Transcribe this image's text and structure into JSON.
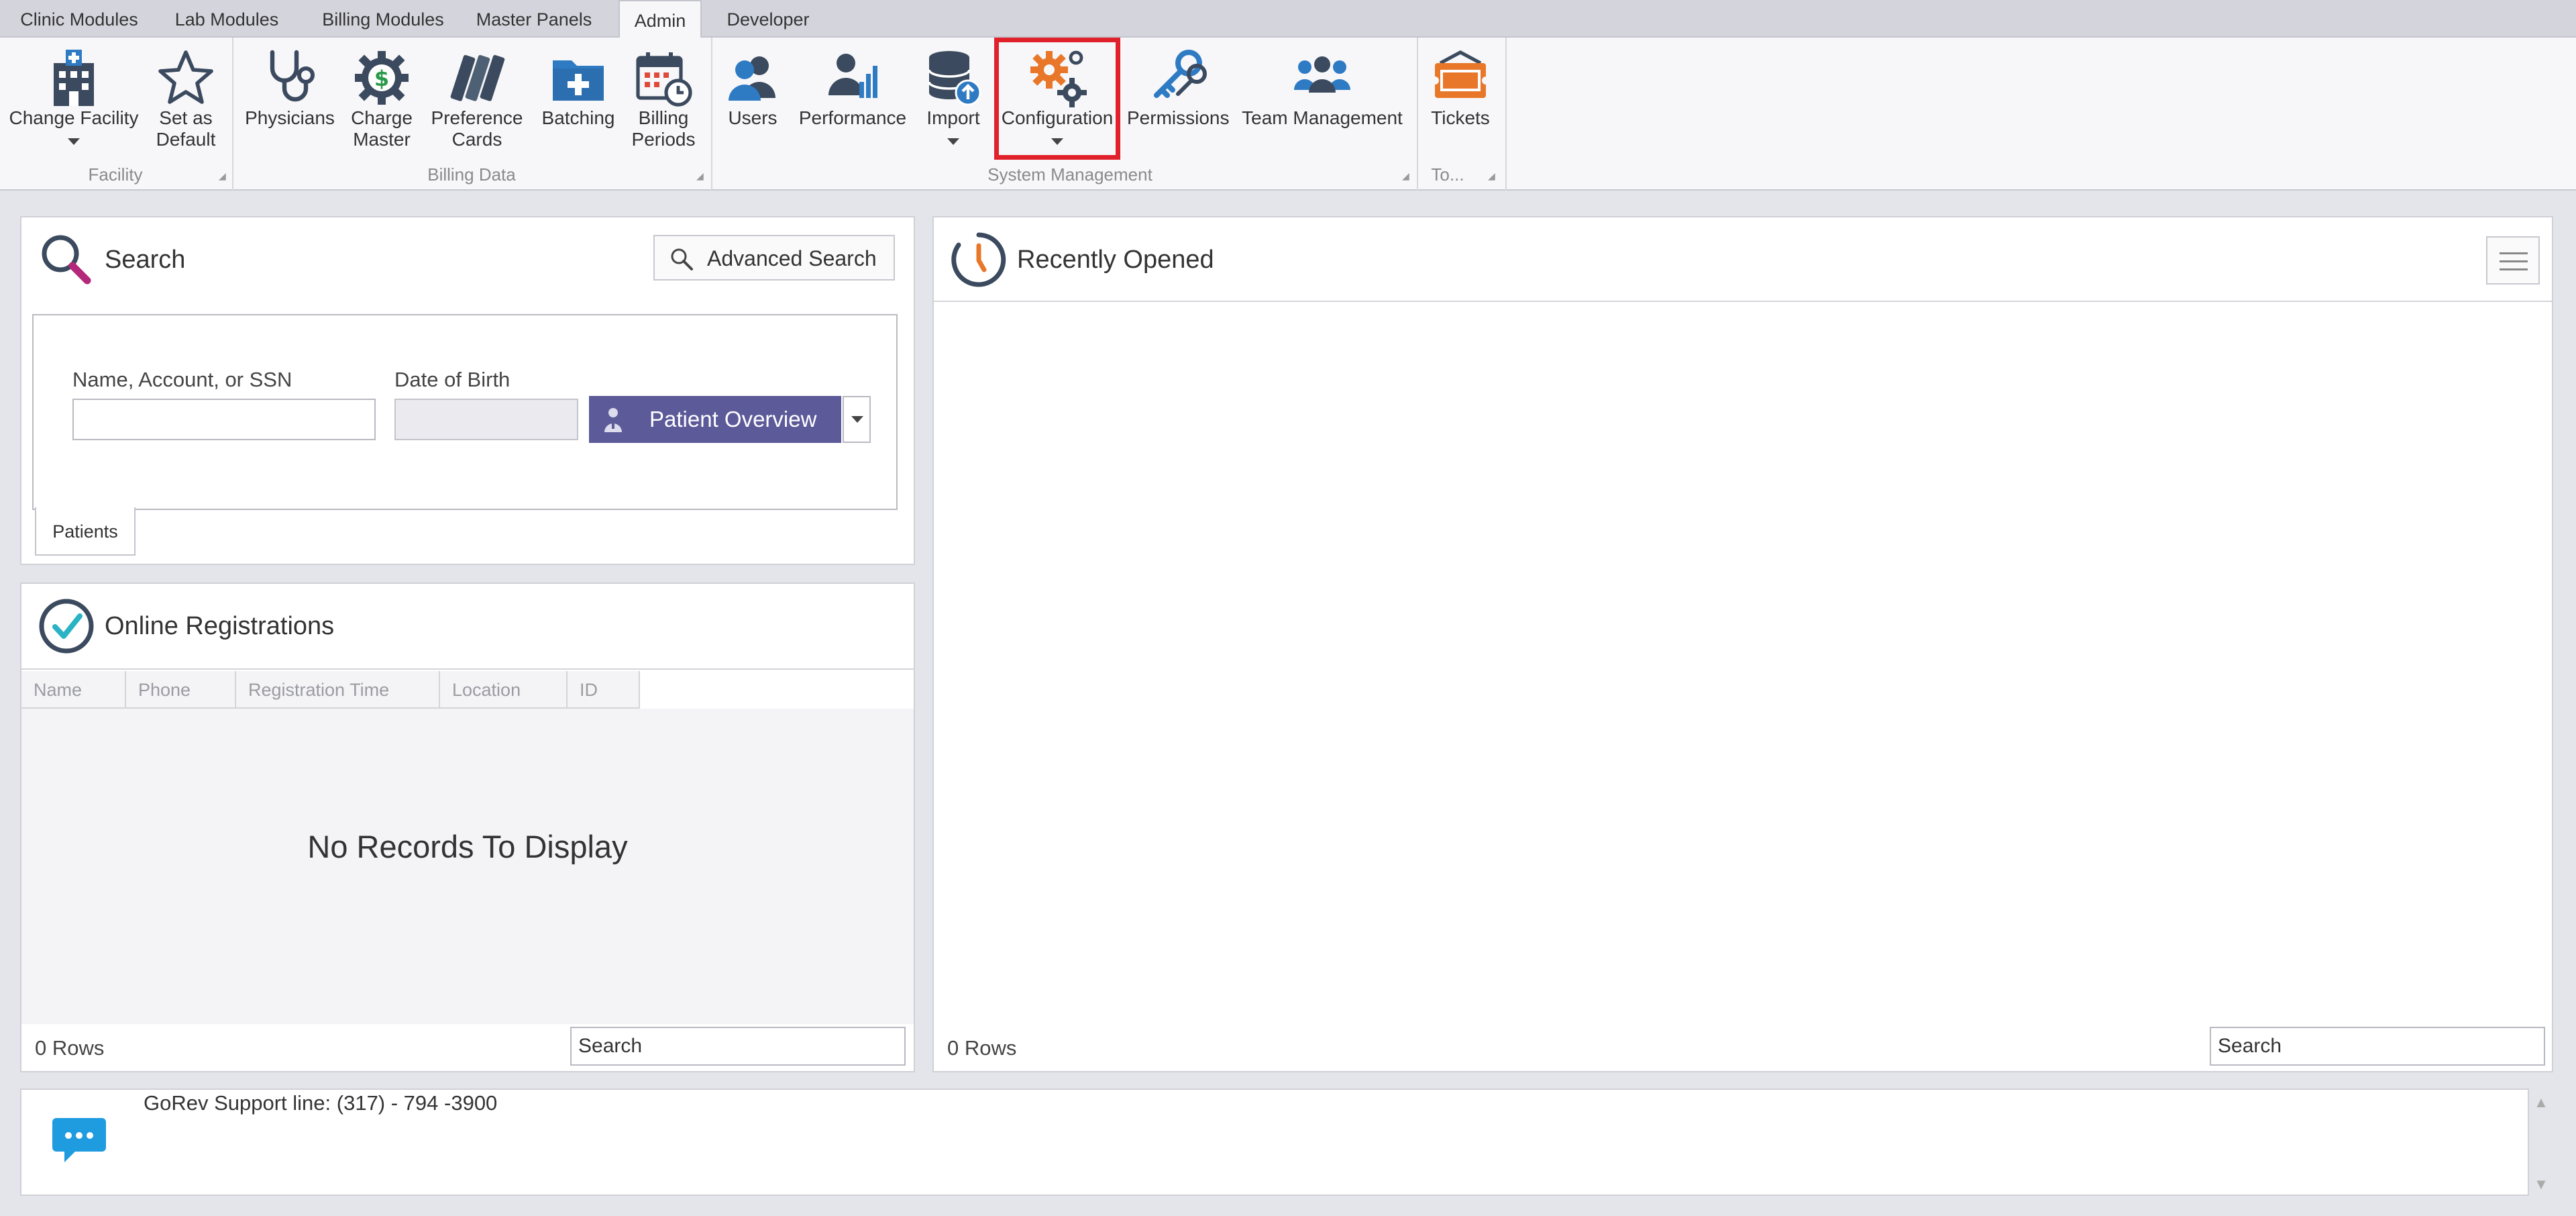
{
  "tabs": [
    {
      "label": "Clinic Modules",
      "active": false
    },
    {
      "label": "Lab Modules",
      "active": false
    },
    {
      "label": "Billing Modules",
      "active": false
    },
    {
      "label": "Master Panels",
      "active": false
    },
    {
      "label": "Admin",
      "active": true
    },
    {
      "label": "Developer",
      "active": false
    }
  ],
  "ribbon": {
    "groups": {
      "facility": "Facility",
      "billing_data": "Billing Data",
      "system_management": "System Management",
      "tools": "To..."
    },
    "buttons": {
      "change_facility": "Change Facility",
      "set_default_1": "Set as",
      "set_default_2": "Default",
      "physicians": "Physicians",
      "charge_master_1": "Charge",
      "charge_master_2": "Master",
      "preference_cards_1": "Preference",
      "preference_cards_2": "Cards",
      "batching": "Batching",
      "billing_periods_1": "Billing",
      "billing_periods_2": "Periods",
      "users": "Users",
      "performance": "Performance",
      "import": "Import",
      "configuration": "Configuration",
      "permissions": "Permissions",
      "team_management": "Team Management",
      "tickets": "Tickets"
    },
    "icons": {
      "change_facility": "hospital-icon",
      "set_default": "star-icon",
      "physicians": "stethoscope-icon",
      "charge_master": "dollar-gear-icon",
      "preference_cards": "cards-icon",
      "batching": "medical-folder-icon",
      "billing_periods": "calendar-clock-icon",
      "users": "users-icon",
      "performance": "user-chart-icon",
      "import": "database-upload-icon",
      "configuration": "gears-icon",
      "permissions": "keys-icon",
      "team_management": "team-icon",
      "tickets": "ticket-icon"
    }
  },
  "search": {
    "title": "Search",
    "advanced_label": "Advanced Search",
    "name_label": "Name, Account, or SSN",
    "name_value": "",
    "dob_label": "Date of Birth",
    "dob_value": "",
    "overview_label": "Patient Overview",
    "subtab": "Patients"
  },
  "registrations": {
    "title": "Online Registrations",
    "columns": [
      "Name",
      "Phone",
      "Registration Time",
      "Location",
      "ID"
    ],
    "empty_text": "No Records To Display",
    "rows_label": "0 Rows",
    "search_placeholder": "Search"
  },
  "recent": {
    "title": "Recently Opened",
    "rows_label": "0 Rows",
    "search_placeholder": "Search"
  },
  "footer": {
    "support_text": "GoRev Support line: (317) - 794 -3900"
  },
  "colors": {
    "accent": "#5c5a99",
    "highlight": "#e0202a",
    "icon_dark": "#3b4a5e",
    "icon_blue": "#2e7bc4",
    "icon_orange": "#e8772a"
  }
}
